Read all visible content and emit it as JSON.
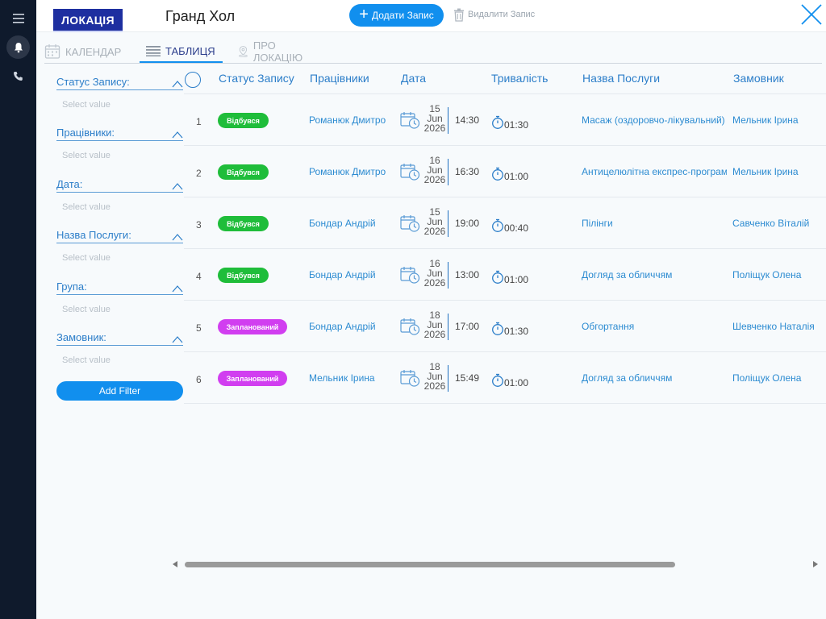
{
  "sidebar": {
    "items": [
      {
        "icon": "menu-icon"
      },
      {
        "icon": "bell-icon",
        "active": true
      },
      {
        "icon": "phone-icon"
      }
    ]
  },
  "header": {
    "badge": "ЛОКАЦІЯ",
    "location_name": "Гранд Хол",
    "add_label": "Додати Запис",
    "delete_label": "Видалити Запис"
  },
  "tabs": [
    {
      "label": "КАЛЕНДАР",
      "icon": "calendar-icon"
    },
    {
      "label": "ТАБЛИЦЯ",
      "icon": "list-icon",
      "active": true
    },
    {
      "label": "ПРО ЛОКАЦІЮ",
      "icon": "location-pin-icon"
    }
  ],
  "filters": {
    "items": [
      {
        "label": "Статус Запису:",
        "placeholder": "Select value"
      },
      {
        "label": "Працівники:",
        "placeholder": "Select value"
      },
      {
        "label": "Дата:",
        "placeholder": "Select value"
      },
      {
        "label": "Назва Послуги:",
        "placeholder": "Select value"
      },
      {
        "label": "Група:",
        "placeholder": "Select value"
      },
      {
        "label": "Замовник:",
        "placeholder": "Select value"
      }
    ],
    "add_label": "Add Filter"
  },
  "table": {
    "columns": [
      "Статус Запису",
      "Працівники",
      "Дата",
      "Тривалість",
      "Назва Послуги",
      "Замовник"
    ],
    "rows": [
      {
        "num": "1",
        "status": "Відбувся",
        "status_type": "done",
        "worker": "Романюк Дмитро",
        "day": "15",
        "month": "Jun",
        "year": "2026",
        "time": "14:30",
        "duration": "01:30",
        "service": "Масаж (оздоровчо-лікувальний)",
        "client": "Мельник Ірина"
      },
      {
        "num": "2",
        "status": "Відбувся",
        "status_type": "done",
        "worker": "Романюк Дмитро",
        "day": "16",
        "month": "Jun",
        "year": "2026",
        "time": "16:30",
        "duration": "01:00",
        "service": "Антицелюлітна експрес-програма",
        "client": "Мельник Ірина"
      },
      {
        "num": "3",
        "status": "Відбувся",
        "status_type": "done",
        "worker": "Бондар Андрій",
        "day": "15",
        "month": "Jun",
        "year": "2026",
        "time": "19:00",
        "duration": "00:40",
        "service": "Пілінги",
        "client": "Савченко Віталій"
      },
      {
        "num": "4",
        "status": "Відбувся",
        "status_type": "done",
        "worker": "Бондар Андрій",
        "day": "16",
        "month": "Jun",
        "year": "2026",
        "time": "13:00",
        "duration": "01:00",
        "service": "Догляд за обличчям",
        "client": "Поліщук Олена"
      },
      {
        "num": "5",
        "status": "Запланований",
        "status_type": "planned",
        "worker": "Бондар Андрій",
        "day": "18",
        "month": "Jun",
        "year": "2026",
        "time": "17:00",
        "duration": "01:30",
        "service": "Обгортання",
        "client": "Шевченко Наталія"
      },
      {
        "num": "6",
        "status": "Запланований",
        "status_type": "planned",
        "worker": "Мельник Ірина",
        "day": "18",
        "month": "Jun",
        "year": "2026",
        "time": "15:49",
        "duration": "01:00",
        "service": "Догляд за обличчям",
        "client": "Поліщук Олена"
      }
    ]
  },
  "colors": {
    "accent": "#118fee",
    "sidebar": "#0f1a2c",
    "badge": "#1e2fa0",
    "status_done": "#1fbd3a",
    "status_planned": "#d13ef0",
    "link": "#2c8bd1"
  }
}
